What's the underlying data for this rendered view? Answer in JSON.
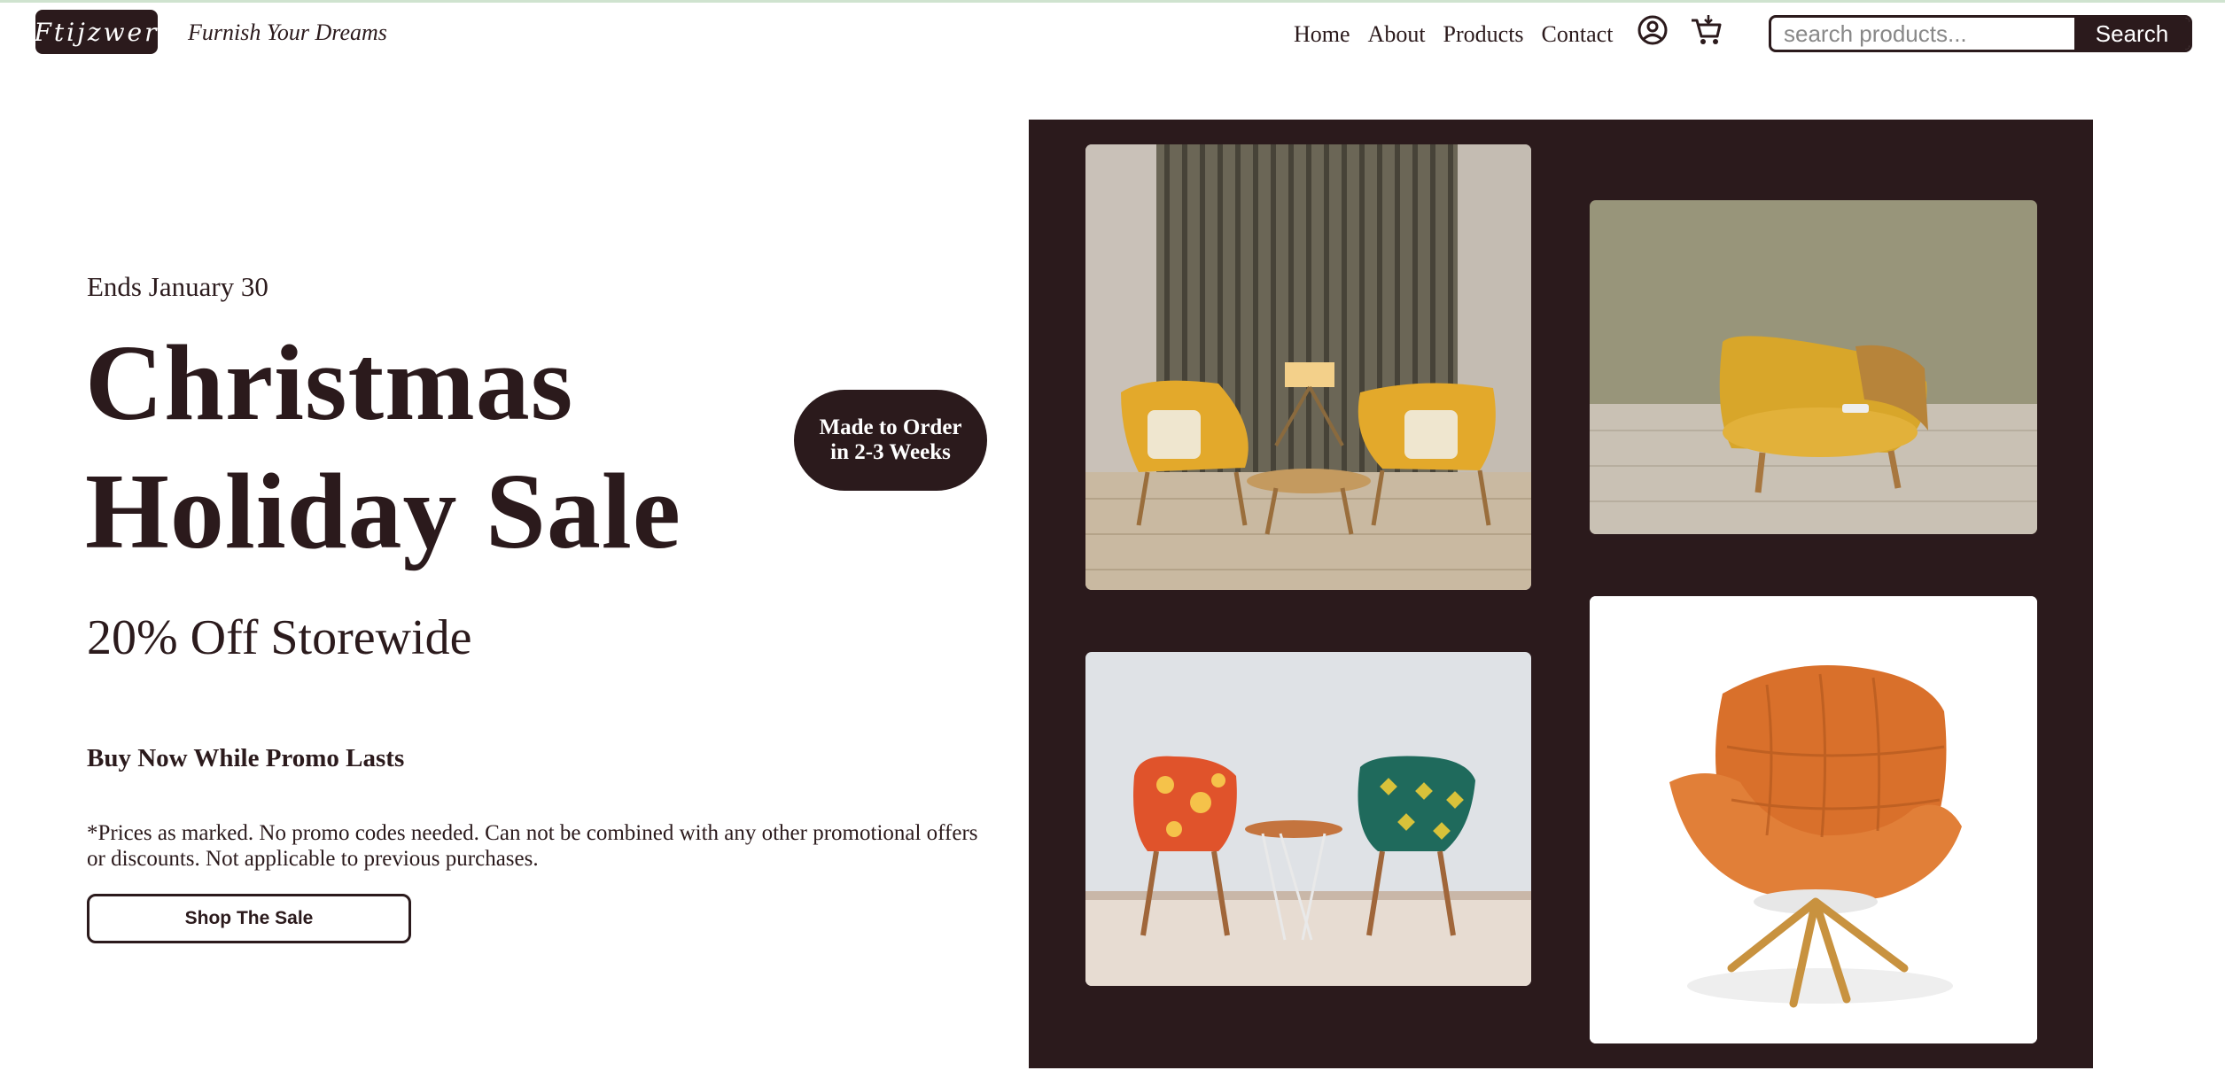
{
  "header": {
    "logo_text": "Ftijzwer",
    "tagline": "Furnish Your Dreams",
    "nav": [
      "Home",
      "About",
      "Products",
      "Contact"
    ],
    "search_placeholder": "search products...",
    "search_button": "Search",
    "icons": [
      "account-icon",
      "cart-icon"
    ]
  },
  "hero": {
    "ends": "Ends January 30",
    "headline_line1": "Christmas",
    "headline_line2": "Holiday Sale",
    "discount": "20% Off Storewide",
    "buy_now": "Buy Now While Promo Lasts",
    "fine_print": "*Prices as marked. No promo codes needed. Can not be combined with any other promotional offers or discounts. Not applicable to previous purchases.",
    "cta": "Shop The Sale",
    "badge_line1": "Made to Order",
    "badge_line2": "in 2-3 Weeks"
  },
  "gallery": {
    "images": [
      "two-yellow-armchairs-with-lamp",
      "yellow-chaise-chair",
      "two-patterned-chairs-with-side-table",
      "orange-padded-lounge-chair"
    ]
  },
  "colors": {
    "brand": "#2b1a1c",
    "background": "#ffffff",
    "accent_mustard": "#e3a92b",
    "accent_orange": "#d9702b"
  }
}
